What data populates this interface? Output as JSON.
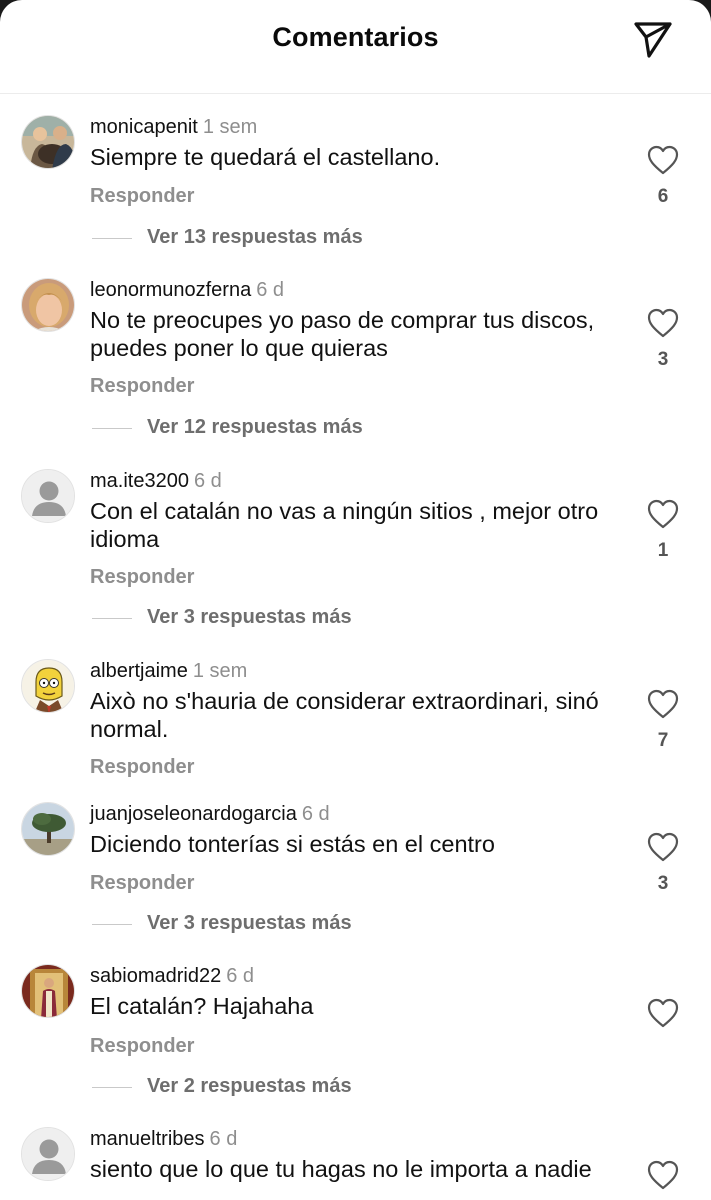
{
  "header": {
    "title": "Comentarios",
    "share_icon": "send-icon"
  },
  "colors": {
    "text": "#111111",
    "muted": "#8e8e8e",
    "background": "#ffffff"
  },
  "comments": [
    {
      "username": "monicapenit",
      "time": "1 sem",
      "text": "Siempre te quedará el castellano.",
      "reply_label": "Responder",
      "likes": "6",
      "replies_label": "Ver 13 respuestas más",
      "avatar": "photo-woman-with-dog"
    },
    {
      "username": "leonormunozferna",
      "time": "6 d",
      "text": "No te preocupes yo paso de comprar tus discos, puedes poner lo que quieras",
      "reply_label": "Responder",
      "likes": "3",
      "replies_label": "Ver 12 respuestas más",
      "avatar": "photo-blonde-woman"
    },
    {
      "username": "ma.ite3200",
      "time": "6 d",
      "text": "Con el catalán no vas a ningún sitios , mejor otro idioma",
      "reply_label": "Responder",
      "likes": "1",
      "replies_label": "Ver 3 respuestas más",
      "avatar": "default-user"
    },
    {
      "username": "albertjaime",
      "time": "1 sem",
      "text": "Això no s'hauria de considerar extraordinari, sinó normal.",
      "reply_label": "Responder",
      "likes": "7",
      "replies_label": "",
      "avatar": "cartoon-character"
    },
    {
      "username": "juanjoseleonardogarcia",
      "time": "6 d",
      "text": "Diciendo tonterías si estás en el centro",
      "reply_label": "Responder",
      "likes": "3",
      "replies_label": "Ver 3 respuestas más",
      "avatar": "photo-tree-landscape"
    },
    {
      "username": "sabiomadrid22",
      "time": "6 d",
      "text": "El catalán? Hajahaha",
      "reply_label": "Responder",
      "likes": "",
      "replies_label": "Ver 2 respuestas más",
      "avatar": "photo-religious-statue"
    },
    {
      "username": "manueltribes",
      "time": "6 d",
      "text": "siento que lo que tu hagas no le importa a nadie",
      "reply_label": "",
      "likes": "",
      "replies_label": "",
      "avatar": "default-user"
    }
  ]
}
